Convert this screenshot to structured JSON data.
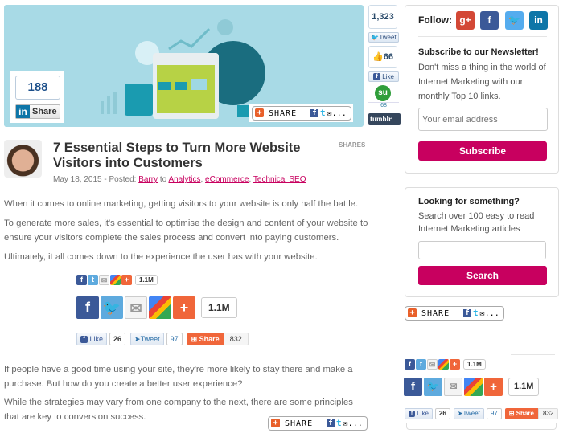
{
  "hero": {
    "linkedin": {
      "count": "188",
      "label": "Share",
      "logo": "in"
    },
    "share_bar": {
      "label": "SHARE",
      "more": "..."
    }
  },
  "vertical_share": {
    "twitter_count": "1,323",
    "twitter_label": "Tweet",
    "facebook_count": "66",
    "facebook_label": "Like",
    "stumble_logo": "su",
    "stumble_count": "68",
    "tumblr_label": "tumblr"
  },
  "sidebar": {
    "follow": {
      "label": "Follow:",
      "icons": [
        {
          "name": "google-plus",
          "glyph": "g+",
          "color": "#d34836"
        },
        {
          "name": "facebook",
          "glyph": "f",
          "color": "#3b5998"
        },
        {
          "name": "twitter",
          "glyph": "t",
          "color": "#55acee"
        },
        {
          "name": "linkedin",
          "glyph": "in",
          "color": "#0e76a8"
        }
      ]
    },
    "newsletter": {
      "title": "Subscribe to our Newsletter!",
      "text": "Don't miss a thing in the world of Internet Marketing with our monthly Top 10 links.",
      "placeholder": "Your email address",
      "button": "Subscribe"
    },
    "search": {
      "title": "Looking for something?",
      "text": "Search over 100 easy to read Internet Marketing articles",
      "placeholder": "",
      "button": "Search"
    },
    "share_bar": {
      "label": "SHARE",
      "more": "..."
    }
  },
  "article": {
    "title": "7 Essential Steps to Turn More Website Visitors into Customers",
    "shares_label": "SHARES",
    "meta": {
      "date": "May 18, 2015",
      "posted": " - Posted: ",
      "author": "Barry",
      "to": " to ",
      "categories": [
        "Analytics",
        "eCommerce",
        "Technical SEO"
      ]
    },
    "paragraphs": [
      "When it comes to online marketing, getting visitors to your website is only half the battle.",
      "To generate more sales, it's essential to optimise the design and content of your website to ensure your visitors complete the sales process and convert into paying customers.",
      "Ultimately, it all comes down to the experience the user has with your website.",
      "If people have a good time using your site, they're more likely to stay there and make a purchase. But how do you create a better user experience?",
      "While the strategies may vary from one company to the next, there are some principles that are key to conversion success."
    ],
    "share_bar": {
      "label": "SHARE",
      "more": "..."
    }
  },
  "share_widgets": {
    "small_count": "1.1M",
    "large_count": "1.1M",
    "like_label": "Like",
    "like_count": "26",
    "tweet_label": "Tweet",
    "tweet_count": "97",
    "share_label": "Share",
    "share_count": "832"
  }
}
